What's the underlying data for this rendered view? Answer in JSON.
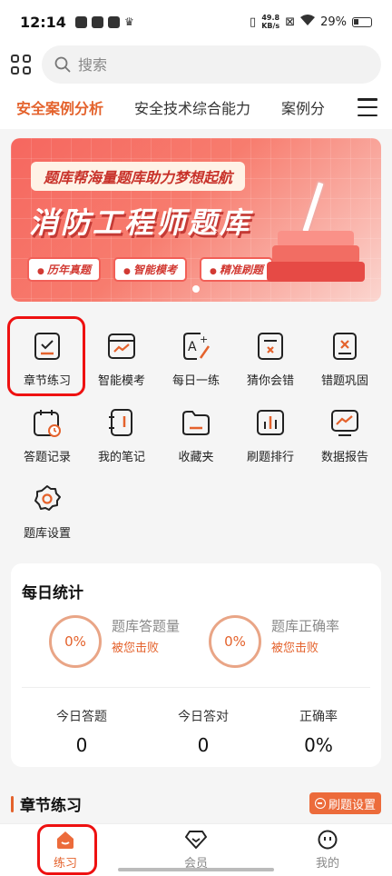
{
  "status_bar": {
    "time": "12:14",
    "net_speed_value": "49.8",
    "net_speed_unit": "KB/s",
    "battery": "29%"
  },
  "search": {
    "placeholder": "搜索"
  },
  "tabs": [
    {
      "label": "安全案例分析",
      "active": true
    },
    {
      "label": "安全技术综合能力",
      "active": false
    },
    {
      "label": "案例分",
      "active": false
    }
  ],
  "banner": {
    "tagline": "题库帮海量题库助力梦想起航",
    "title": "消防工程师题库",
    "pills": [
      "历年真题",
      "智能模考",
      "精准刷题"
    ]
  },
  "features": [
    {
      "label": "章节练习",
      "icon": "chapter-practice-icon"
    },
    {
      "label": "智能模考",
      "icon": "smart-exam-icon"
    },
    {
      "label": "每日一练",
      "icon": "daily-practice-icon"
    },
    {
      "label": "猜你会错",
      "icon": "guess-wrong-icon"
    },
    {
      "label": "错题巩固",
      "icon": "wrong-question-icon"
    },
    {
      "label": "答题记录",
      "icon": "answer-record-icon"
    },
    {
      "label": "我的笔记",
      "icon": "notes-icon"
    },
    {
      "label": "收藏夹",
      "icon": "favorites-icon"
    },
    {
      "label": "刷题排行",
      "icon": "ranking-icon"
    },
    {
      "label": "数据报告",
      "icon": "data-report-icon"
    },
    {
      "label": "题库设置",
      "icon": "settings-icon"
    }
  ],
  "daily_stats": {
    "title": "每日统计",
    "rings": [
      {
        "value": "0%",
        "label": "题库答题量",
        "sub": "被您击败"
      },
      {
        "value": "0%",
        "label": "题库正确率",
        "sub": "被您击败"
      }
    ],
    "columns": [
      {
        "label": "今日答题",
        "value": "0"
      },
      {
        "label": "今日答对",
        "value": "0"
      },
      {
        "label": "正确率",
        "value": "0%"
      }
    ]
  },
  "section": {
    "title": "章节练习",
    "button": "刷题设置"
  },
  "bottom_nav": [
    {
      "label": "练习",
      "active": true
    },
    {
      "label": "会员",
      "active": false
    },
    {
      "label": "我的",
      "active": false
    }
  ],
  "colors": {
    "accent": "#e4622c",
    "highlight": "#ee1111",
    "banner": "#f6675f"
  }
}
